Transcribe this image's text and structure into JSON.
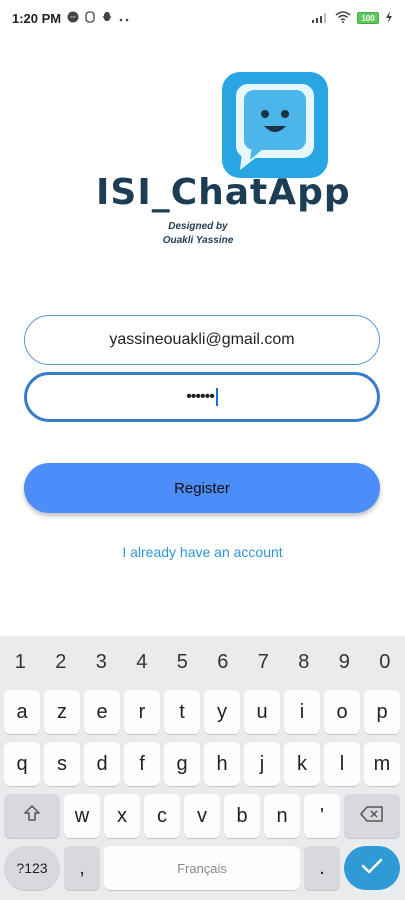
{
  "status_bar": {
    "time": "1:20 PM",
    "battery": "100"
  },
  "logo": {
    "title": "ISI_ChatApp",
    "designed_by": "Designed by",
    "author": "Ouakli Yassine"
  },
  "form": {
    "email_value": "yassineouakli@gmail.com",
    "password_value": "••••••",
    "register_label": "Register",
    "account_link": "I already have an account"
  },
  "keyboard": {
    "numbers": [
      "1",
      "2",
      "3",
      "4",
      "5",
      "6",
      "7",
      "8",
      "9",
      "0"
    ],
    "row1": [
      "a",
      "z",
      "e",
      "r",
      "t",
      "y",
      "u",
      "i",
      "o",
      "p"
    ],
    "row2": [
      "q",
      "s",
      "d",
      "f",
      "g",
      "h",
      "j",
      "k",
      "l",
      "m"
    ],
    "row3": [
      "w",
      "x",
      "c",
      "v",
      "b",
      "n",
      "'"
    ],
    "symbols_key": "?123",
    "comma_key": ",",
    "space_label": "Français",
    "period_key": "."
  },
  "colors": {
    "accent": "#4c8dfa",
    "link": "#2f95d8",
    "icon_blue": "#2aa5e3"
  },
  "icons": [
    "messenger-icon",
    "snapchat-icon",
    "signal-icon",
    "wifi-icon",
    "battery-icon",
    "charging-icon",
    "shift-icon",
    "backspace-icon",
    "check-icon"
  ]
}
